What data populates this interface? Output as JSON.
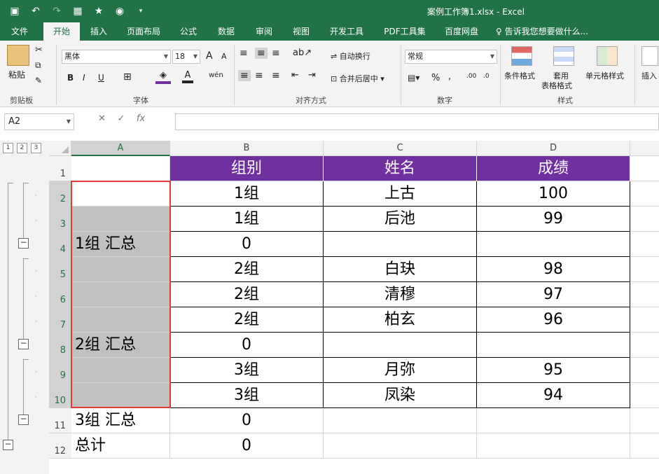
{
  "title": "案例工作簿1.xlsx - Excel",
  "tabs": [
    {
      "label": "文件"
    },
    {
      "label": "开始"
    },
    {
      "label": "插入"
    },
    {
      "label": "页面布局"
    },
    {
      "label": "公式"
    },
    {
      "label": "数据"
    },
    {
      "label": "审阅"
    },
    {
      "label": "视图"
    },
    {
      "label": "开发工具"
    },
    {
      "label": "PDF工具集"
    },
    {
      "label": "百度网盘"
    }
  ],
  "tell_me": "告诉我您想要做什么...",
  "ribbon": {
    "paste": "粘贴",
    "clipboard": "剪贴板",
    "font_name": "黑体",
    "font_size": "18",
    "font_group": "字体",
    "wrap_text": "自动换行",
    "merge_center": "合并后居中",
    "alignment_group": "对齐方式",
    "number_format": "常规",
    "number_group": "数字",
    "conditional_format": "条件格式",
    "table_format_1": "套用",
    "table_format_2": "表格格式",
    "cell_styles": "单元格样式",
    "styles_group": "样式",
    "insert": "插入",
    "bold": "B",
    "italic": "I",
    "underline": "U",
    "font_grow": "A",
    "font_shrink": "A",
    "font_color": "A",
    "pinyin": "wén"
  },
  "namebox": "A2",
  "fx": "fx",
  "outline_levels": [
    "1",
    "2",
    "3"
  ],
  "columns": [
    "A",
    "B",
    "C",
    "D"
  ],
  "rows": [
    {
      "num": "1",
      "a": "",
      "b": "组别",
      "c": "姓名",
      "d": "成绩"
    },
    {
      "num": "2",
      "a": "",
      "b": "1组",
      "c": "上古",
      "d": "100"
    },
    {
      "num": "3",
      "a": "",
      "b": "1组",
      "c": "后池",
      "d": "99"
    },
    {
      "num": "4",
      "a": "1组 汇总",
      "b": "0",
      "c": "",
      "d": ""
    },
    {
      "num": "5",
      "a": "",
      "b": "2组",
      "c": "白玦",
      "d": "98"
    },
    {
      "num": "6",
      "a": "",
      "b": "2组",
      "c": "清穆",
      "d": "97"
    },
    {
      "num": "7",
      "a": "",
      "b": "2组",
      "c": "柏玄",
      "d": "96"
    },
    {
      "num": "8",
      "a": "2组 汇总",
      "b": "0",
      "c": "",
      "d": ""
    },
    {
      "num": "9",
      "a": "",
      "b": "3组",
      "c": "月弥",
      "d": "95"
    },
    {
      "num": "10",
      "a": "",
      "b": "3组",
      "c": "凤染",
      "d": "94"
    },
    {
      "num": "11",
      "a": "3组 汇总",
      "b": "0",
      "c": "",
      "d": ""
    },
    {
      "num": "12",
      "a": "总计",
      "b": "0",
      "c": "",
      "d": ""
    }
  ],
  "colors": {
    "excel_green": "#217346",
    "header_purple": "#7030a0",
    "selection_red": "#e03c31",
    "shade_gray": "#c0c0c0"
  }
}
